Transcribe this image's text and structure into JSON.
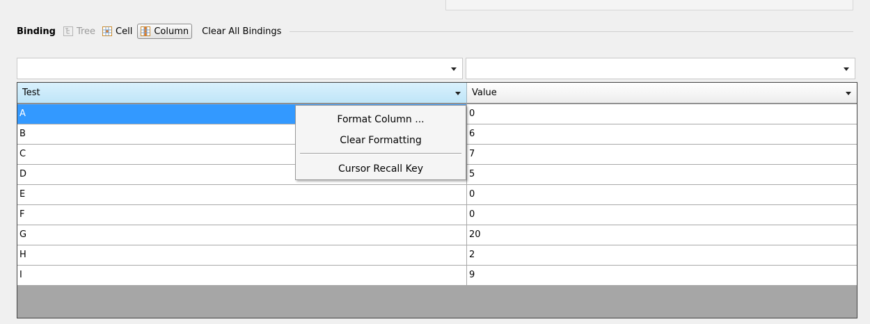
{
  "toolbar": {
    "binding_label": "Binding",
    "tree_label": "Tree",
    "cell_label": "Cell",
    "column_label": "Column",
    "clear_all_label": "Clear All Bindings",
    "icons": {
      "tree": "tree-icon",
      "cell": "cell-grid-icon",
      "column": "column-grid-icon"
    }
  },
  "filters": [
    {
      "value": "",
      "icon": "chevron-down-icon"
    },
    {
      "value": "",
      "icon": "chevron-down-icon"
    }
  ],
  "grid": {
    "columns": [
      "Test",
      "Value"
    ],
    "rows": [
      [
        "A",
        "0"
      ],
      [
        "B",
        "6"
      ],
      [
        "C",
        "7"
      ],
      [
        "D",
        "5"
      ],
      [
        "E",
        "0"
      ],
      [
        "F",
        "0"
      ],
      [
        "G",
        "20"
      ],
      [
        "H",
        "2"
      ],
      [
        "I",
        "9"
      ]
    ],
    "selected_row": 0,
    "colors": {
      "selected": "#3399ff",
      "header_selected": "#bfe5f8"
    }
  },
  "context_menu": {
    "items": [
      "Format Column ...",
      "Clear Formatting",
      "Cursor Recall Key"
    ]
  }
}
